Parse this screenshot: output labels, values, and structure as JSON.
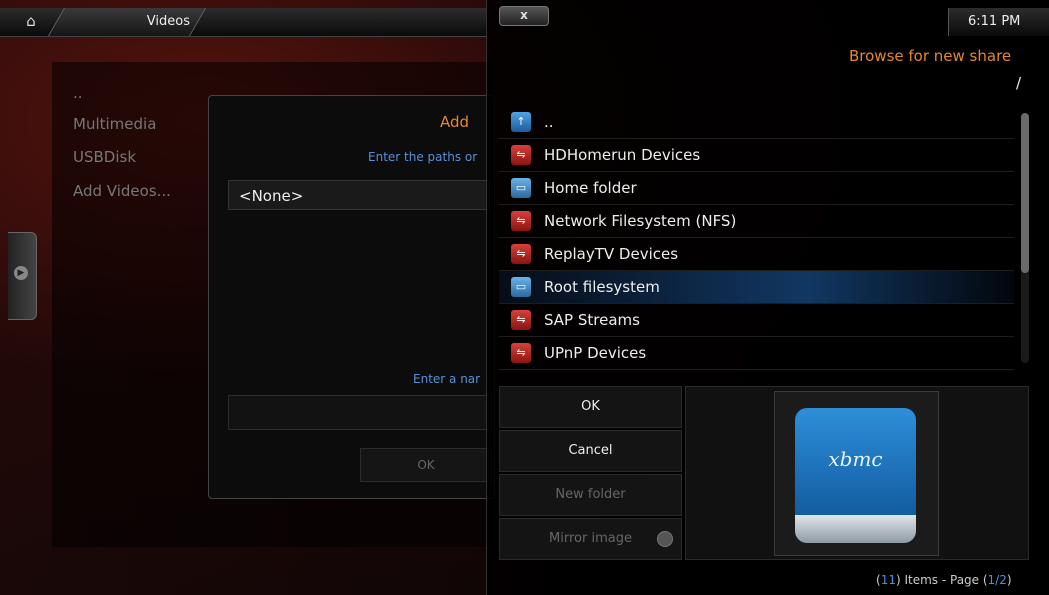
{
  "header": {
    "breadcrumb": "Videos",
    "close_label": "x",
    "time": "6:11 PM"
  },
  "left_list": {
    "items": [
      "..",
      "Multimedia",
      "USBDisk",
      "Add Videos..."
    ]
  },
  "add_dialog": {
    "title": "Add",
    "paths_label": "Enter the paths or",
    "path_value": "<None>",
    "name_label": "Enter a nar",
    "ok_label": "OK"
  },
  "browser": {
    "title": "Browse for new share",
    "path": "/",
    "items": [
      {
        "label": "..",
        "icon": "up-arrow-icon"
      },
      {
        "label": "HDHomerun Devices",
        "icon": "network-drive-icon"
      },
      {
        "label": "Home folder",
        "icon": "local-drive-icon"
      },
      {
        "label": "Network Filesystem (NFS)",
        "icon": "network-drive-icon"
      },
      {
        "label": "ReplayTV Devices",
        "icon": "network-drive-icon"
      },
      {
        "label": "Root filesystem",
        "icon": "local-drive-icon"
      },
      {
        "label": "SAP Streams",
        "icon": "network-drive-icon"
      },
      {
        "label": "UPnP Devices",
        "icon": "network-drive-icon"
      }
    ],
    "selected_index": 5,
    "buttons": {
      "ok": "OK",
      "cancel": "Cancel",
      "new_folder": "New folder",
      "mirror_image": "Mirror image"
    },
    "preview_logo": "xbmc",
    "footer": {
      "count": "11",
      "items_page_text": ") Items - Page (",
      "page": "1/2",
      "close_paren": ")",
      "open_paren": "("
    }
  },
  "colors": {
    "accent_orange": "#e5872e",
    "accent_blue": "#4a90e2",
    "selection_blue": "#1e64b4"
  }
}
